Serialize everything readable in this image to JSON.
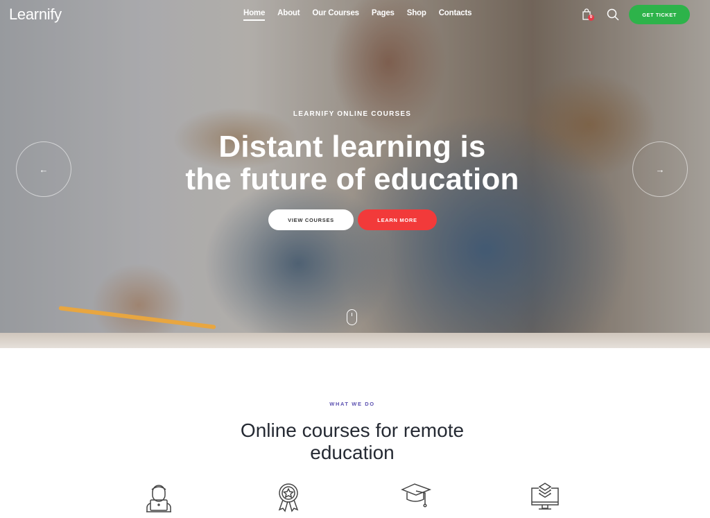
{
  "header": {
    "logo": "Learnify",
    "nav": [
      {
        "label": "Home",
        "active": true
      },
      {
        "label": "About",
        "active": false
      },
      {
        "label": "Our Courses",
        "active": false
      },
      {
        "label": "Pages",
        "active": false
      },
      {
        "label": "Shop",
        "active": false
      },
      {
        "label": "Contacts",
        "active": false
      }
    ],
    "cart_icon": "shopping-bag-icon",
    "cart_count": "0",
    "search_icon": "search-icon",
    "cta_label": "GET TICKET"
  },
  "hero": {
    "kicker": "LEARNIFY ONLINE COURSES",
    "title_line1": "Distant learning is",
    "title_line2": "the future of education",
    "primary_button": "VIEW COURSES",
    "secondary_button": "LEARN MORE",
    "prev_icon": "arrow-left-icon",
    "next_icon": "arrow-right-icon",
    "scroll_icon": "mouse-scroll-icon",
    "prev_glyph": "←",
    "next_glyph": "→"
  },
  "section": {
    "kicker": "WHAT WE DO",
    "title_line1": "Online courses for remote",
    "title_line2": "education",
    "features": [
      {
        "icon": "student-laptop-icon"
      },
      {
        "icon": "award-badge-icon"
      },
      {
        "icon": "graduation-cap-icon"
      },
      {
        "icon": "monitor-layers-icon"
      }
    ]
  },
  "colors": {
    "accent_green": "#2db34a",
    "accent_red": "#f23a3a",
    "kicker_purple": "#5a4fb0",
    "heading_dark": "#252a33"
  }
}
